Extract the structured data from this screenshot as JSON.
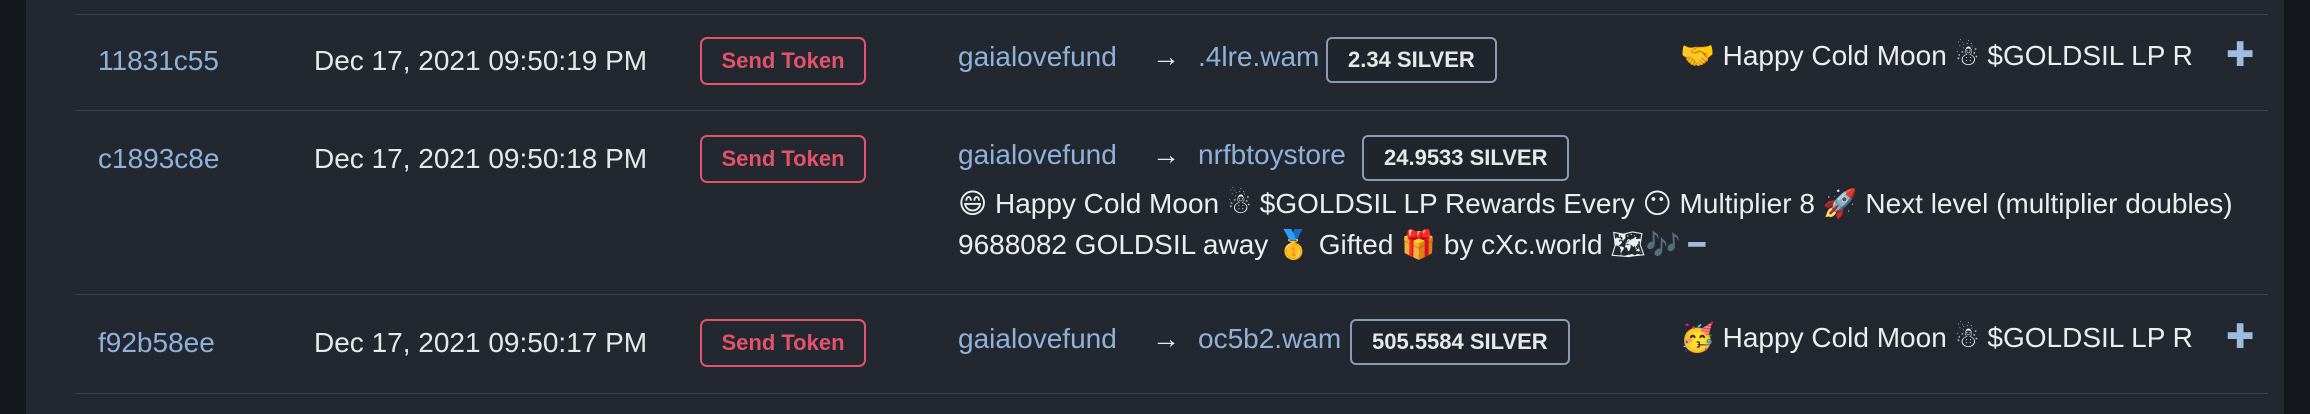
{
  "transactions": [
    {
      "id": "11831c55",
      "date": "Dec 17, 2021 09:50:19 PM",
      "action": "Send Token",
      "from": "gaialovefund",
      "arrow": "→",
      "to": ".4lre.wam",
      "amount": "2.34 SILVER",
      "memo": "🤝 Happy Cold Moon ☃ $GOLDSIL LP R",
      "toggle": "✚"
    },
    {
      "id": "c1893c8e",
      "date": "Dec 17, 2021 09:50:18 PM",
      "action": "Send Token",
      "from": "gaialovefund",
      "arrow": "→",
      "to": "nrfbtoystore",
      "amount": "24.9533 SILVER",
      "memo_line1": "😄 Happy Cold Moon ☃ $GOLDSIL LP Rewards Every 😶 Multiplier 8 🚀 Next level (multiplier doubles)",
      "memo_line2": "9688082 GOLDSIL away 🥇 Gifted 🎁 by cXc.world 🗺🎶",
      "toggle": "━"
    },
    {
      "id": "f92b58ee",
      "date": "Dec 17, 2021 09:50:17 PM",
      "action": "Send Token",
      "from": "gaialovefund",
      "arrow": "→",
      "to": "oc5b2.wam",
      "amount": "505.5584 SILVER",
      "memo": "🥳 Happy Cold Moon ☃ $GOLDSIL LP R",
      "toggle": "✚"
    }
  ]
}
